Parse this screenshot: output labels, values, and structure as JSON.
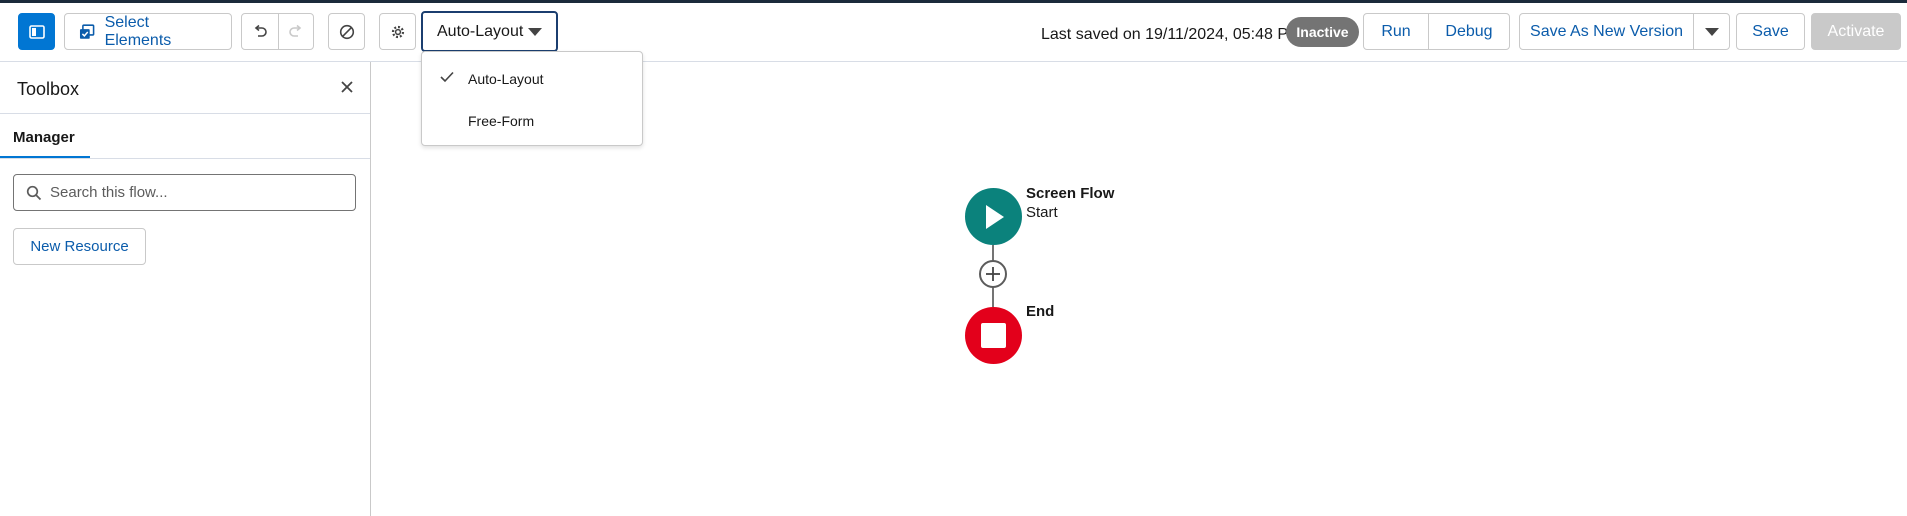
{
  "toolbar": {
    "select_elements_label": "Select Elements",
    "layout_select_value": "Auto-Layout",
    "last_saved": "Last saved on 19/11/2024, 05:48 PM",
    "status_badge": "Inactive",
    "run_label": "Run",
    "debug_label": "Debug",
    "save_as_new_version_label": "Save As New Version",
    "save_label": "Save",
    "activate_label": "Activate"
  },
  "layout_dropdown": {
    "options": [
      {
        "label": "Auto-Layout",
        "selected": true
      },
      {
        "label": "Free-Form",
        "selected": false
      }
    ]
  },
  "sidebar": {
    "title": "Toolbox",
    "tabs": [
      {
        "label": "Manager",
        "active": true
      }
    ],
    "search_placeholder": "Search this flow...",
    "new_resource_label": "New Resource"
  },
  "canvas": {
    "start_node": {
      "title": "Screen Flow",
      "subtitle": "Start"
    },
    "end_node": {
      "title": "End"
    }
  },
  "colors": {
    "brand_blue": "#0176d3",
    "link_blue": "#0b5cab",
    "start_green": "#0b827c",
    "end_red": "#e3001b",
    "badge_gray": "#747474"
  },
  "icons": {
    "toggle_panel": "panel-toggle-icon",
    "select_elements": "select-elements-icon",
    "undo": "undo-icon",
    "redo": "redo-icon",
    "clear": "ban-icon",
    "settings": "gear-icon",
    "caret": "caret-down-icon",
    "close": "close-icon",
    "search": "search-icon",
    "start": "play-icon",
    "end": "stop-icon",
    "add": "plus-icon",
    "check": "check-icon"
  }
}
